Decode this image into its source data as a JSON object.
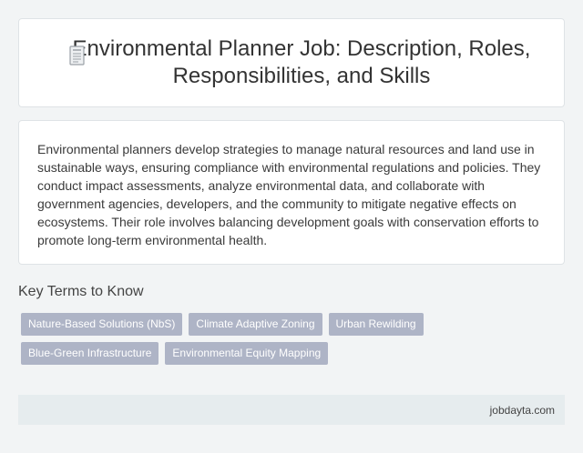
{
  "header": {
    "title": "Environmental Planner Job: Description, Roles, Responsibilities, and Skills",
    "icon": "document-icon"
  },
  "description": {
    "text": "Environmental planners develop strategies to manage natural resources and land use in sustainable ways, ensuring compliance with environmental regulations and policies. They conduct impact assessments, analyze environmental data, and collaborate with government agencies, developers, and the community to mitigate negative effects on ecosystems. Their role involves balancing development goals with conservation efforts to promote long-term environmental health."
  },
  "key_terms": {
    "heading": "Key Terms to Know",
    "items": [
      "Nature-Based Solutions (NbS)",
      "Climate Adaptive Zoning",
      "Urban Rewilding",
      "Blue-Green Infrastructure",
      "Environmental Equity Mapping"
    ]
  },
  "footer": {
    "site": "jobdayta.com"
  },
  "colors": {
    "background": "#f2f4f5",
    "chip": "#aeb4c6",
    "footer": "#e6ecee"
  }
}
